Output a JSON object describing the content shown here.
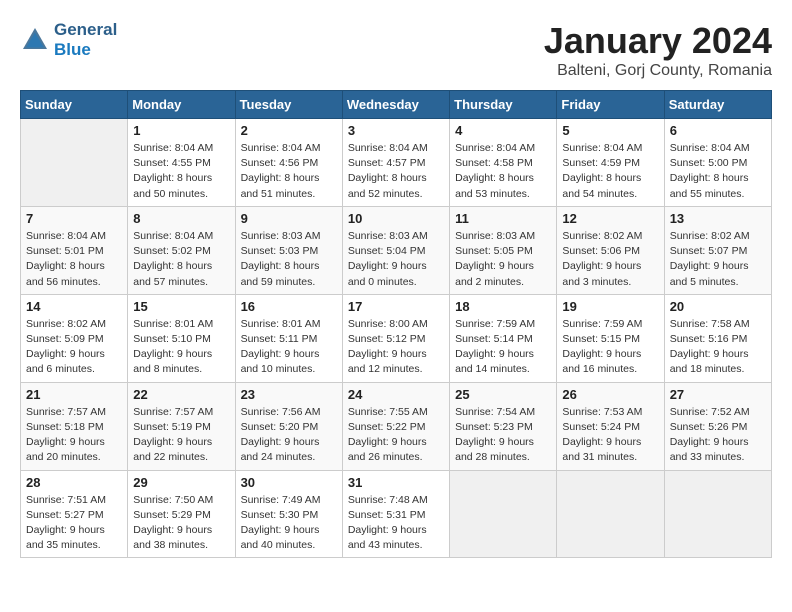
{
  "header": {
    "logo_line1": "General",
    "logo_line2": "Blue",
    "month_title": "January 2024",
    "subtitle": "Balteni, Gorj County, Romania"
  },
  "weekdays": [
    "Sunday",
    "Monday",
    "Tuesday",
    "Wednesday",
    "Thursday",
    "Friday",
    "Saturday"
  ],
  "weeks": [
    [
      {
        "day": "",
        "sunrise": "",
        "sunset": "",
        "daylight": ""
      },
      {
        "day": "1",
        "sunrise": "Sunrise: 8:04 AM",
        "sunset": "Sunset: 4:55 PM",
        "daylight": "Daylight: 8 hours and 50 minutes."
      },
      {
        "day": "2",
        "sunrise": "Sunrise: 8:04 AM",
        "sunset": "Sunset: 4:56 PM",
        "daylight": "Daylight: 8 hours and 51 minutes."
      },
      {
        "day": "3",
        "sunrise": "Sunrise: 8:04 AM",
        "sunset": "Sunset: 4:57 PM",
        "daylight": "Daylight: 8 hours and 52 minutes."
      },
      {
        "day": "4",
        "sunrise": "Sunrise: 8:04 AM",
        "sunset": "Sunset: 4:58 PM",
        "daylight": "Daylight: 8 hours and 53 minutes."
      },
      {
        "day": "5",
        "sunrise": "Sunrise: 8:04 AM",
        "sunset": "Sunset: 4:59 PM",
        "daylight": "Daylight: 8 hours and 54 minutes."
      },
      {
        "day": "6",
        "sunrise": "Sunrise: 8:04 AM",
        "sunset": "Sunset: 5:00 PM",
        "daylight": "Daylight: 8 hours and 55 minutes."
      }
    ],
    [
      {
        "day": "7",
        "sunrise": "Sunrise: 8:04 AM",
        "sunset": "Sunset: 5:01 PM",
        "daylight": "Daylight: 8 hours and 56 minutes."
      },
      {
        "day": "8",
        "sunrise": "Sunrise: 8:04 AM",
        "sunset": "Sunset: 5:02 PM",
        "daylight": "Daylight: 8 hours and 57 minutes."
      },
      {
        "day": "9",
        "sunrise": "Sunrise: 8:03 AM",
        "sunset": "Sunset: 5:03 PM",
        "daylight": "Daylight: 8 hours and 59 minutes."
      },
      {
        "day": "10",
        "sunrise": "Sunrise: 8:03 AM",
        "sunset": "Sunset: 5:04 PM",
        "daylight": "Daylight: 9 hours and 0 minutes."
      },
      {
        "day": "11",
        "sunrise": "Sunrise: 8:03 AM",
        "sunset": "Sunset: 5:05 PM",
        "daylight": "Daylight: 9 hours and 2 minutes."
      },
      {
        "day": "12",
        "sunrise": "Sunrise: 8:02 AM",
        "sunset": "Sunset: 5:06 PM",
        "daylight": "Daylight: 9 hours and 3 minutes."
      },
      {
        "day": "13",
        "sunrise": "Sunrise: 8:02 AM",
        "sunset": "Sunset: 5:07 PM",
        "daylight": "Daylight: 9 hours and 5 minutes."
      }
    ],
    [
      {
        "day": "14",
        "sunrise": "Sunrise: 8:02 AM",
        "sunset": "Sunset: 5:09 PM",
        "daylight": "Daylight: 9 hours and 6 minutes."
      },
      {
        "day": "15",
        "sunrise": "Sunrise: 8:01 AM",
        "sunset": "Sunset: 5:10 PM",
        "daylight": "Daylight: 9 hours and 8 minutes."
      },
      {
        "day": "16",
        "sunrise": "Sunrise: 8:01 AM",
        "sunset": "Sunset: 5:11 PM",
        "daylight": "Daylight: 9 hours and 10 minutes."
      },
      {
        "day": "17",
        "sunrise": "Sunrise: 8:00 AM",
        "sunset": "Sunset: 5:12 PM",
        "daylight": "Daylight: 9 hours and 12 minutes."
      },
      {
        "day": "18",
        "sunrise": "Sunrise: 7:59 AM",
        "sunset": "Sunset: 5:14 PM",
        "daylight": "Daylight: 9 hours and 14 minutes."
      },
      {
        "day": "19",
        "sunrise": "Sunrise: 7:59 AM",
        "sunset": "Sunset: 5:15 PM",
        "daylight": "Daylight: 9 hours and 16 minutes."
      },
      {
        "day": "20",
        "sunrise": "Sunrise: 7:58 AM",
        "sunset": "Sunset: 5:16 PM",
        "daylight": "Daylight: 9 hours and 18 minutes."
      }
    ],
    [
      {
        "day": "21",
        "sunrise": "Sunrise: 7:57 AM",
        "sunset": "Sunset: 5:18 PM",
        "daylight": "Daylight: 9 hours and 20 minutes."
      },
      {
        "day": "22",
        "sunrise": "Sunrise: 7:57 AM",
        "sunset": "Sunset: 5:19 PM",
        "daylight": "Daylight: 9 hours and 22 minutes."
      },
      {
        "day": "23",
        "sunrise": "Sunrise: 7:56 AM",
        "sunset": "Sunset: 5:20 PM",
        "daylight": "Daylight: 9 hours and 24 minutes."
      },
      {
        "day": "24",
        "sunrise": "Sunrise: 7:55 AM",
        "sunset": "Sunset: 5:22 PM",
        "daylight": "Daylight: 9 hours and 26 minutes."
      },
      {
        "day": "25",
        "sunrise": "Sunrise: 7:54 AM",
        "sunset": "Sunset: 5:23 PM",
        "daylight": "Daylight: 9 hours and 28 minutes."
      },
      {
        "day": "26",
        "sunrise": "Sunrise: 7:53 AM",
        "sunset": "Sunset: 5:24 PM",
        "daylight": "Daylight: 9 hours and 31 minutes."
      },
      {
        "day": "27",
        "sunrise": "Sunrise: 7:52 AM",
        "sunset": "Sunset: 5:26 PM",
        "daylight": "Daylight: 9 hours and 33 minutes."
      }
    ],
    [
      {
        "day": "28",
        "sunrise": "Sunrise: 7:51 AM",
        "sunset": "Sunset: 5:27 PM",
        "daylight": "Daylight: 9 hours and 35 minutes."
      },
      {
        "day": "29",
        "sunrise": "Sunrise: 7:50 AM",
        "sunset": "Sunset: 5:29 PM",
        "daylight": "Daylight: 9 hours and 38 minutes."
      },
      {
        "day": "30",
        "sunrise": "Sunrise: 7:49 AM",
        "sunset": "Sunset: 5:30 PM",
        "daylight": "Daylight: 9 hours and 40 minutes."
      },
      {
        "day": "31",
        "sunrise": "Sunrise: 7:48 AM",
        "sunset": "Sunset: 5:31 PM",
        "daylight": "Daylight: 9 hours and 43 minutes."
      },
      {
        "day": "",
        "sunrise": "",
        "sunset": "",
        "daylight": ""
      },
      {
        "day": "",
        "sunrise": "",
        "sunset": "",
        "daylight": ""
      },
      {
        "day": "",
        "sunrise": "",
        "sunset": "",
        "daylight": ""
      }
    ]
  ]
}
